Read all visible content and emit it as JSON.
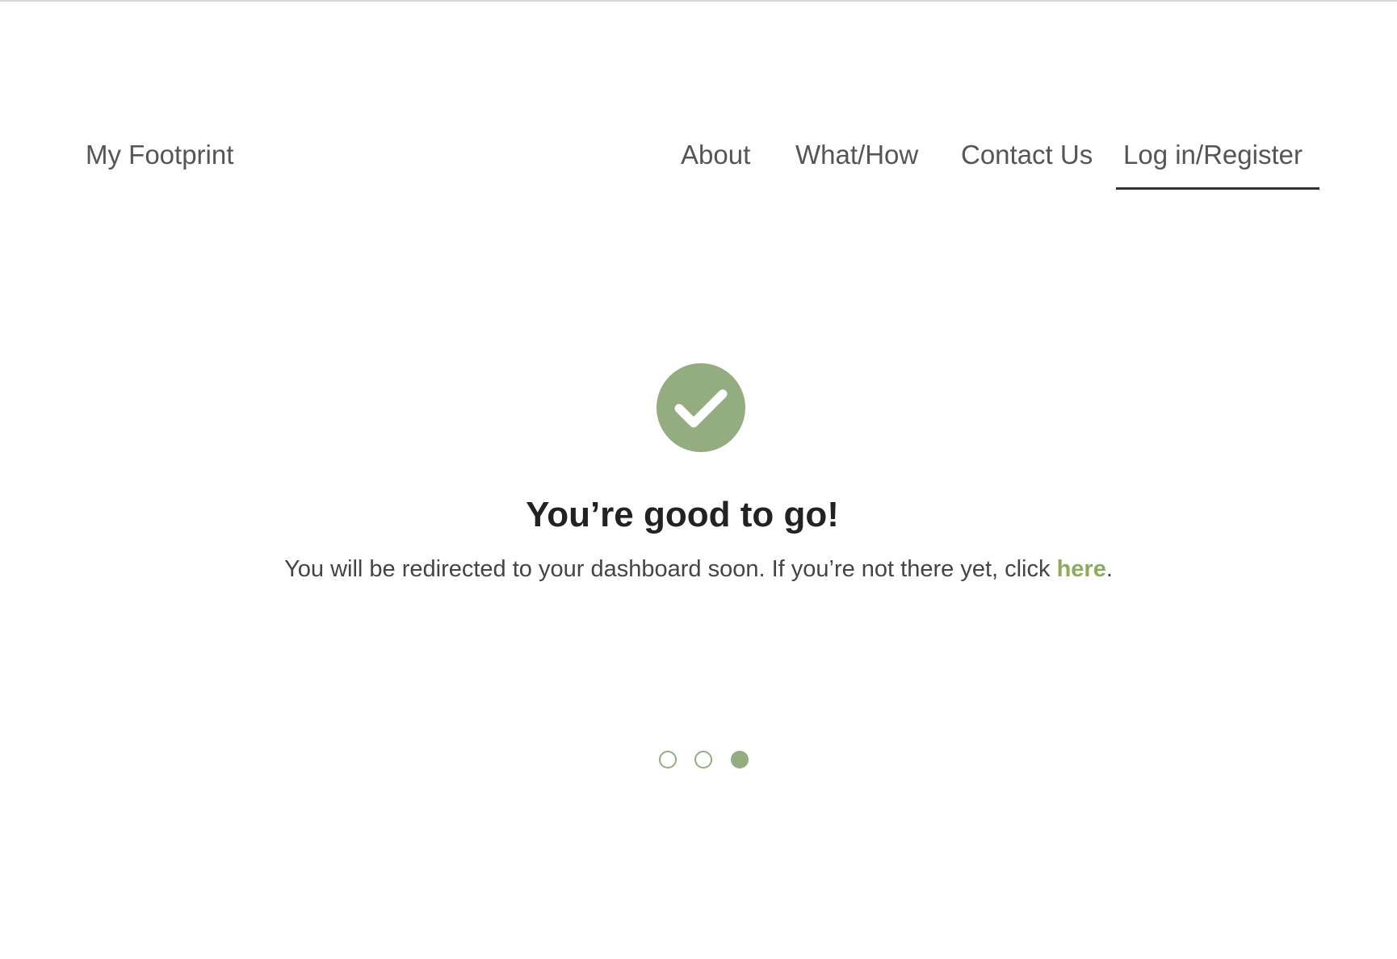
{
  "header": {
    "brand": "My Footprint",
    "nav": {
      "about": "About",
      "what_how": "What/How",
      "contact": "Contact Us",
      "login": "Log in/Register"
    },
    "active_nav": "Log in/Register"
  },
  "main": {
    "icon": "check-circle-icon",
    "title": "You’re good to go!",
    "message_prefix": "You will be redirected to your dashboard soon. If you’re not there yet, click ",
    "link_text": "here",
    "message_suffix": "."
  },
  "progress": {
    "total_steps": 3,
    "current_step": 3
  },
  "colors": {
    "accent": "#93ad80",
    "link": "#8eaa5c",
    "text": "#444444",
    "heading": "#222222"
  }
}
